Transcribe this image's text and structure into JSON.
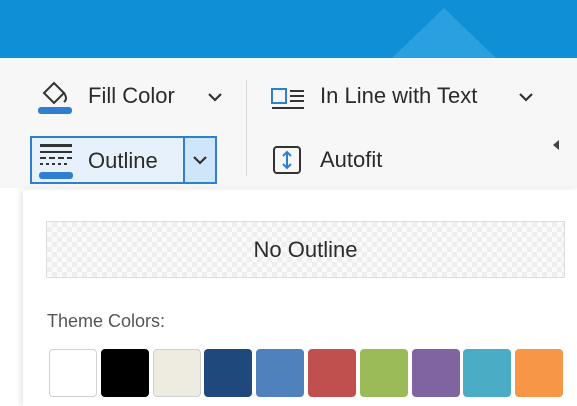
{
  "ribbon": {
    "fill_color": {
      "label": "Fill Color",
      "icon": "paint-bucket-icon",
      "accent": "#2e7fd1"
    },
    "outline": {
      "label": "Outline",
      "icon": "outline-lines-icon",
      "accent": "#2e7fd1"
    },
    "wrap": {
      "label": "In Line with Text",
      "icon": "inline-with-text-icon"
    },
    "autofit": {
      "label": "Autofit",
      "icon": "autofit-icon"
    }
  },
  "dropdown": {
    "no_outline_label": "No Outline",
    "theme_colors_label": "Theme Colors:",
    "theme_colors": [
      "#ffffff",
      "#000000",
      "#eeece1",
      "#1f497d",
      "#4f81bd",
      "#c0504d",
      "#9bbb59",
      "#8064a2",
      "#4bacc6",
      "#f79646"
    ]
  }
}
